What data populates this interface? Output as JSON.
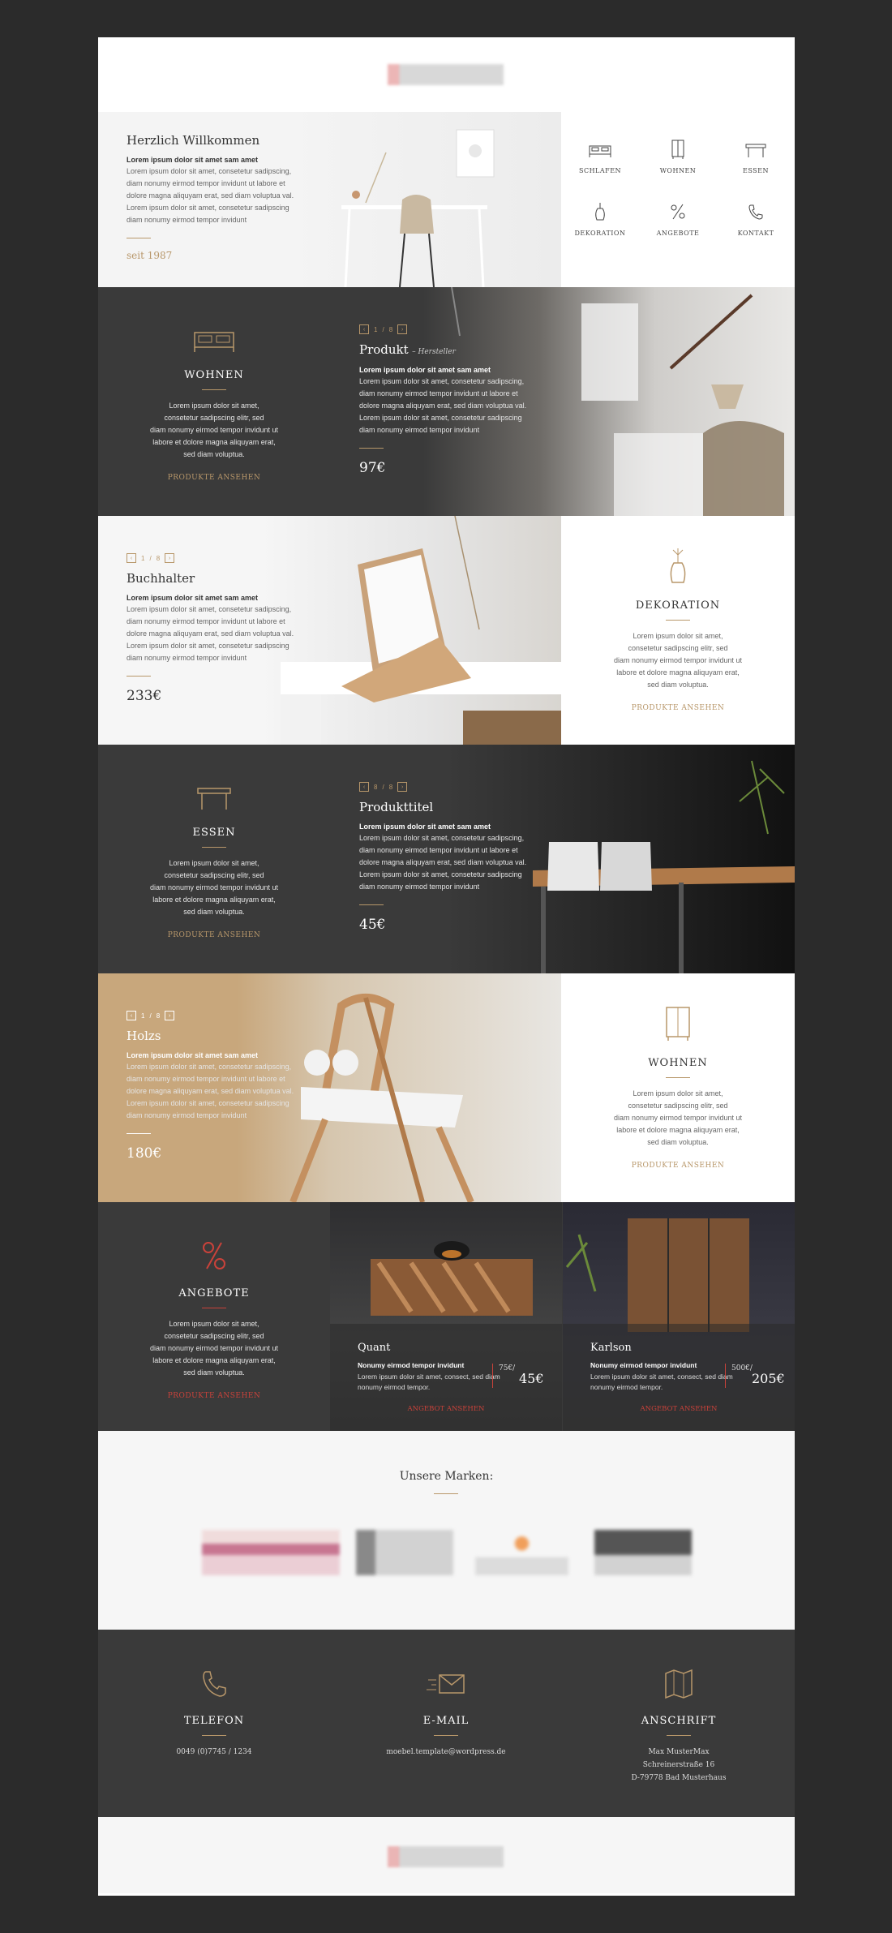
{
  "welcome": {
    "title": "Herzlich Willkommen",
    "lead": "Lorem ipsum dolor sit amet sam amet",
    "body": [
      "Lorem ipsum dolor sit amet, consetetur sadipscing,",
      "diam nonumy eirmod tempor invidunt ut labore et",
      "dolore magna aliquyam erat, sed diam voluptua val.",
      "Lorem ipsum dolor sit amet, consetetur sadipscing",
      "diam nonumy eirmod tempor invidunt"
    ],
    "since": "seit 1987"
  },
  "categories": [
    "SCHLAFEN",
    "WOHNEN",
    "ESSEN",
    "DEKORATION",
    "ANGEBOTE",
    "KONTAKT"
  ],
  "cat_body": [
    "Lorem ipsum dolor sit amet,",
    "consetetur sadipscing elitr, sed",
    "diam nonumy eirmod tempor invidunt ut",
    "labore et dolore magna aliquyam erat,",
    "sed diam voluptua."
  ],
  "cat_link": "PRODUKTE ANSEHEN",
  "row1": {
    "cat": "WOHNEN",
    "pager_a": "1",
    "pager_b": "8",
    "title": "Produkt",
    "maker": "– Hersteller",
    "lead": "Lorem ipsum dolor sit amet sam amet",
    "body": [
      "Lorem ipsum dolor sit amet, consetetur sadipscing,",
      "diam nonumy eirmod tempor invidunt ut labore et",
      "dolore magna aliquyam erat, sed diam voluptua val.",
      "Lorem ipsum dolor sit amet, consetetur sadipscing",
      "diam nonumy eirmod tempor invidunt"
    ],
    "price": "97€"
  },
  "row2": {
    "cat": "DEKORATION",
    "pager_a": "1",
    "pager_b": "8",
    "title": "Buchhalter",
    "lead": "Lorem ipsum dolor sit amet sam amet",
    "body": [
      "Lorem ipsum dolor sit amet, consetetur sadipscing,",
      "diam nonumy eirmod tempor invidunt ut labore et",
      "dolore magna aliquyam erat, sed diam voluptua val.",
      "Lorem ipsum dolor sit amet, consetetur sadipscing",
      "diam nonumy eirmod tempor invidunt"
    ],
    "price": "233€"
  },
  "row3": {
    "cat": "ESSEN",
    "pager_a": "8",
    "pager_b": "8",
    "title": "Produkttitel",
    "lead": "Lorem ipsum dolor sit amet sam amet",
    "body": [
      "Lorem ipsum dolor sit amet, consetetur sadipscing,",
      "diam nonumy eirmod tempor invidunt ut labore et",
      "dolore magna aliquyam erat, sed diam voluptua val.",
      "Lorem ipsum dolor sit amet, consetetur sadipscing",
      "diam nonumy eirmod tempor invidunt"
    ],
    "price": "45€"
  },
  "row4": {
    "cat": "WOHNEN",
    "pager_a": "1",
    "pager_b": "8",
    "title": "Holzs",
    "lead": "Lorem ipsum dolor sit amet sam amet",
    "body": [
      "Lorem ipsum dolor sit amet, consetetur sadipscing,",
      "diam nonumy eirmod tempor invidunt ut labore et",
      "dolore magna aliquyam erat, sed diam voluptua val.",
      "Lorem ipsum dolor sit amet, consetetur sadipscing",
      "diam nonumy eirmod tempor invidunt"
    ],
    "price": "180€"
  },
  "offers": {
    "cat": "ANGEBOTE",
    "link": "PRODUKTE ANSEHEN",
    "items": [
      {
        "name": "Quant",
        "l1": "Nonumy eirmod tempor invidunt",
        "l2": "Lorem ipsum dolor sit amet, consect, sed diam nonumy eirmod tempor.",
        "old": "75€/",
        "new": "45€",
        "link": "ANGEBOT ANSEHEN"
      },
      {
        "name": "Karlson",
        "l1": "Nonumy eirmod tempor invidunt",
        "l2": "Lorem ipsum dolor sit amet, consect, sed diam nonumy eirmod tempor.",
        "old": "500€/",
        "new": "205€",
        "link": "ANGEBOT ANSEHEN"
      }
    ]
  },
  "brands": {
    "title": "Unsere Marken:"
  },
  "contact": {
    "phone": {
      "title": "TELEFON",
      "value": "0049 (0)7745 / 1234"
    },
    "mail": {
      "title": "E-MAIL",
      "value": "moebel.template@wordpress.de"
    },
    "address": {
      "title": "ANSCHRIFT",
      "lines": [
        "Max MusterMax",
        "Schreinerstraße 16",
        "D-79778 Bad Musterhaus"
      ]
    }
  },
  "colors": {
    "gold": "#b8976a",
    "red": "#c9423a",
    "dark": "#3a3a3a",
    "bg": "#2b2b2b"
  }
}
